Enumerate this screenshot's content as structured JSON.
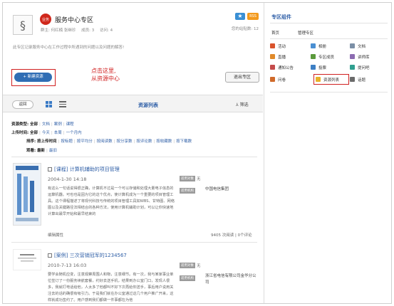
{
  "header": {
    "logo_glyph": "§",
    "badge": "业务",
    "title": "服务中心专区",
    "owner": "群主: 何红楠 张继珍",
    "members": "成员: 3",
    "visits": "访问: 4",
    "share": "您的站贴数: 12",
    "desc": "此专区记录服务中心在工作过程中所遇到的问题以及问题的解答!"
  },
  "actions": {
    "new_resource": "+ 新建资源",
    "note_line1": "点击这里,",
    "note_line2": "从资源中心",
    "exit": "退出专区"
  },
  "toolbar": {
    "back": "返回",
    "list_title": "资源列表",
    "filter": "筛选"
  },
  "filters": {
    "type_label": "资源类型:",
    "type_options": [
      "全部",
      "文档",
      "案例",
      "课程"
    ],
    "time_label": "上传时间:",
    "time_options": [
      "全部",
      "今天",
      "本周",
      "一个月内"
    ],
    "sort_label": "排序:",
    "sort_current": "按上传时间",
    "sort_options": [
      "按标题",
      "按平均分",
      "按阅读数",
      "按分享数",
      "按评论数",
      "按收藏数",
      "按下载数"
    ],
    "view_label": "观看:",
    "view_options": [
      "最新",
      "最旧"
    ]
  },
  "items": [
    {
      "type": "[课程]",
      "name": "计算机辅助的项目管理",
      "date": "2004-1-30 14:18",
      "tag1": "适用对象",
      "tag2": "适用机构",
      "audience": "无",
      "org": "中国电信集团",
      "desc": "有这么一句话说得很正确，计算机不过是一个可以存储和处理大量电子信息的运算机器。可也也是因为它的这个优点，使计算机成为一个重要的项目管理工具。这个课程描述了将现代科技与传统的项目管理工具如WBS、甘特图、网络图以及关键路径法相结合的各种方法，使用计算机辅助计划，可以让你快速地计算出最早开始和最早结束的",
      "edit": "编辑属性",
      "stats": "9405 次阅读 | 0个评论"
    },
    {
      "type": "[案例]",
      "name": "三次营销冠军的1234567",
      "date": "2010-7-13 16:03",
      "tag1": "适用对象",
      "tag2": "适用机构",
      "audience": "无",
      "org": "浙江省电信有限公司金华分公司",
      "desc": "要学会随机应变，注意观察周围人和物，注意细节。有一次，我与某家事业单位签订了一份服务续航套餐，约好去送手机，结果到办公室门口，发现人很多，我就打电话给他，人太多了他都叫不好下次再给你送手，事后用户说用关注去的话的确很有吸引力。于是我们就在办公室通过这几个用户推广开来，这样就成功签约了。用户感到我们都做一件事都在为他"
    }
  ],
  "sidebar": {
    "title": "专区组件",
    "nav": [
      "首页",
      "管理专区"
    ],
    "items": [
      {
        "label": "活动",
        "icon": "activity-icon",
        "color": "#d9532c"
      },
      {
        "label": "相册",
        "icon": "album-icon",
        "color": "#4a8fd2"
      },
      {
        "label": "文档",
        "icon": "document-icon",
        "color": "#7b8fa6"
      },
      {
        "label": "直播",
        "icon": "live-icon",
        "color": "#e08a2a"
      },
      {
        "label": "专区成员",
        "icon": "members-icon",
        "color": "#5b9a3c"
      },
      {
        "label": "讲师库",
        "icon": "lecturer-icon",
        "color": "#8c6bb1"
      },
      {
        "label": "通知公告",
        "icon": "notice-icon",
        "color": "#c44b4b"
      },
      {
        "label": "投票",
        "icon": "vote-icon",
        "color": "#3d7fc4"
      },
      {
        "label": "提问吧",
        "icon": "question-icon",
        "color": "#2f9f8f"
      },
      {
        "label": "问卷",
        "icon": "survey-icon",
        "color": "#d06a2a"
      },
      {
        "label": "资源列表",
        "icon": "resource-list-icon",
        "color": "#e8b12a"
      },
      {
        "label": "话题",
        "icon": "topic-icon",
        "color": "#6a6a6a"
      }
    ]
  }
}
